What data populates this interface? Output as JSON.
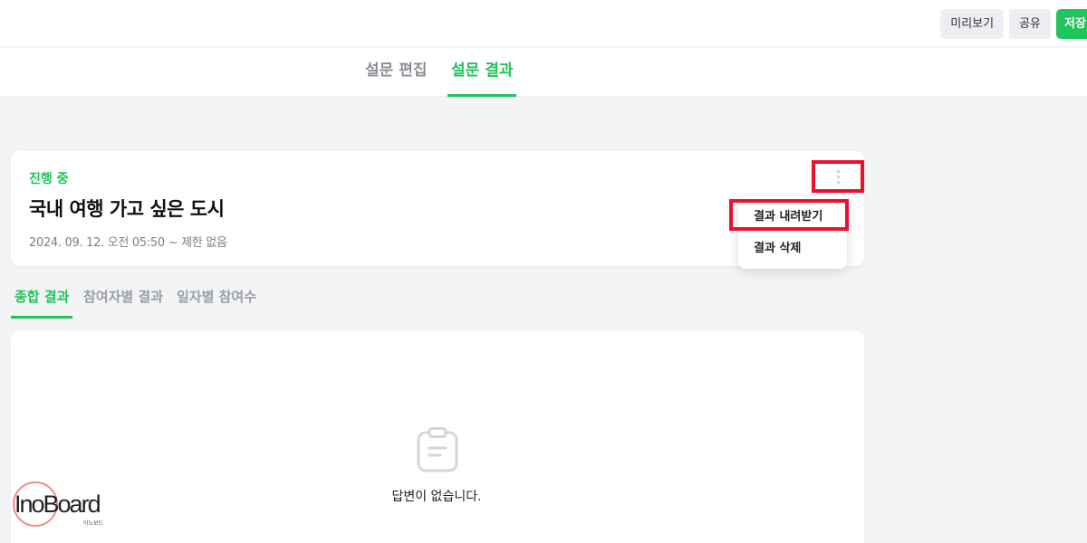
{
  "header": {
    "preview_label": "미리보기",
    "share_label": "공유",
    "save_label": "저장"
  },
  "main_tabs": [
    {
      "label": "설문 편집",
      "active": false
    },
    {
      "label": "설문 결과",
      "active": true
    }
  ],
  "survey": {
    "status": "진행 중",
    "title": "국내 여행 가고 싶은 도시",
    "date_range": "2024. 09. 12. 오전 05:50 ~ 제한 없음"
  },
  "menu": {
    "more_icon": "kebab-vertical-icon",
    "items": [
      {
        "label": "결과 내려받기",
        "highlighted": true
      },
      {
        "label": "결과 삭제",
        "highlighted": false
      }
    ]
  },
  "result_tabs": [
    {
      "label": "종합 결과",
      "active": true
    },
    {
      "label": "참여자별 결과",
      "active": false
    },
    {
      "label": "일자별 참여수",
      "active": false
    }
  ],
  "results": {
    "empty_icon": "clipboard-icon",
    "empty_text": "답변이 없습니다."
  },
  "watermark": {
    "brand": "InoBoard",
    "sub": "이노보드"
  },
  "colors": {
    "accent": "#1fc45a",
    "highlight": "#e8132b"
  }
}
